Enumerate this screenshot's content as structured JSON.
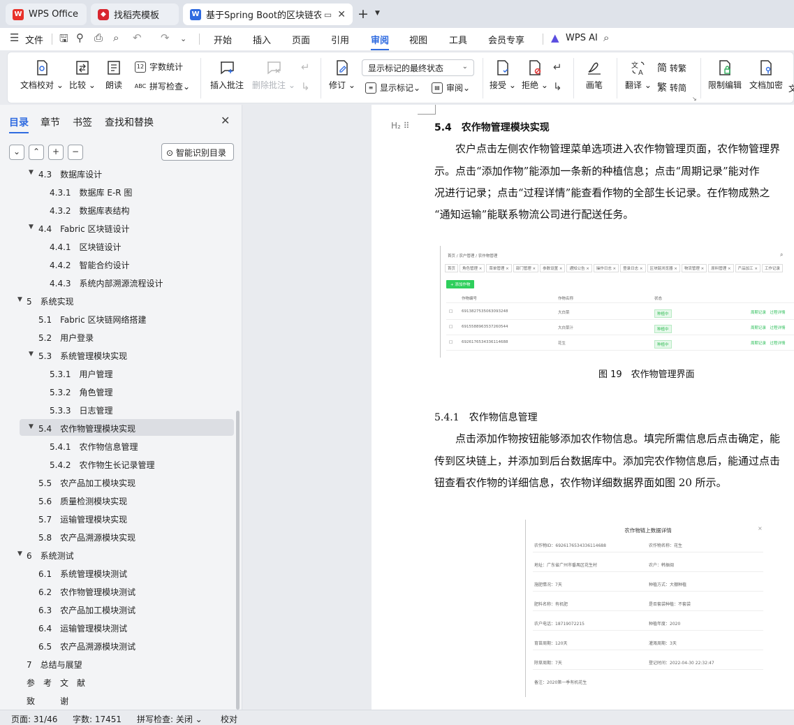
{
  "tabs": {
    "wps": "WPS Office",
    "template": "找稻壳模板",
    "doc": "基于Spring Boot的区块链农产"
  },
  "menu": {
    "file": "文件",
    "items": [
      "开始",
      "插入",
      "页面",
      "引用",
      "审阅",
      "视图",
      "工具",
      "会员专享"
    ],
    "active": "审阅",
    "wps_ai": "WPS AI"
  },
  "ribbon": {
    "doc_proof": "文档校对",
    "compare": "比较",
    "read_aloud": "朗读",
    "word_count": "字数统计",
    "spell_check": "拼写检查",
    "insert_comment": "插入批注",
    "delete_comment": "删除批注",
    "revise": "修订",
    "show_markup": "显示标记",
    "review": "审阅",
    "display_mode": "显示标记的最终状态",
    "accept": "接受",
    "reject": "拒绝",
    "pen": "画笔",
    "translate": "翻译",
    "to_traditional": "转繁",
    "to_simplified": "转简",
    "restrict_edit": "限制编辑",
    "doc_encrypt": "文档加密",
    "trailing": "文"
  },
  "nav": {
    "tabs": [
      "目录",
      "章节",
      "书签",
      "查找和替换"
    ],
    "smart_toc": "智能识别目录",
    "toc": [
      {
        "num": "4.3",
        "text": "数据库设计",
        "level": 2,
        "tw": true
      },
      {
        "num": "4.3.1",
        "text": "数据库 E-R 图",
        "level": 3
      },
      {
        "num": "4.3.2",
        "text": "数据库表结构",
        "level": 3
      },
      {
        "num": "4.4",
        "text": "Fabric 区块链设计",
        "level": 2,
        "tw": true
      },
      {
        "num": "4.4.1",
        "text": "区块链设计",
        "level": 3
      },
      {
        "num": "4.4.2",
        "text": "智能合约设计",
        "level": 3
      },
      {
        "num": "4.4.3",
        "text": "系统内部溯源流程设计",
        "level": 3
      },
      {
        "num": "5",
        "text": "系统实现",
        "level": 1,
        "tw": true
      },
      {
        "num": "5.1",
        "text": "Fabric 区块链网络搭建",
        "level": 2
      },
      {
        "num": "5.2",
        "text": "用户登录",
        "level": 2
      },
      {
        "num": "5.3",
        "text": "系统管理模块实现",
        "level": 2,
        "tw": true
      },
      {
        "num": "5.3.1",
        "text": "用户管理",
        "level": 3
      },
      {
        "num": "5.3.2",
        "text": "角色管理",
        "level": 3
      },
      {
        "num": "5.3.3",
        "text": "日志管理",
        "level": 3
      },
      {
        "num": "5.4",
        "text": "农作物管理模块实现",
        "level": 2,
        "tw": true,
        "selected": true
      },
      {
        "num": "5.4.1",
        "text": "农作物信息管理",
        "level": 3
      },
      {
        "num": "5.4.2",
        "text": "农作物生长记录管理",
        "level": 3
      },
      {
        "num": "5.5",
        "text": "农产品加工模块实现",
        "level": 2
      },
      {
        "num": "5.6",
        "text": "质量检测模块实现",
        "level": 2
      },
      {
        "num": "5.7",
        "text": "运输管理模块实现",
        "level": 2
      },
      {
        "num": "5.8",
        "text": "农产品溯源模块实现",
        "level": 2
      },
      {
        "num": "6",
        "text": "系统测试",
        "level": 1,
        "tw": true
      },
      {
        "num": "6.1",
        "text": "系统管理模块测试",
        "level": 2
      },
      {
        "num": "6.2",
        "text": "农作物管理模块测试",
        "level": 2
      },
      {
        "num": "6.3",
        "text": "农产品加工模块测试",
        "level": 2
      },
      {
        "num": "6.4",
        "text": "运输管理模块测试",
        "level": 2
      },
      {
        "num": "6.5",
        "text": "农产品溯源模块测试",
        "level": 2
      },
      {
        "num": "7",
        "text": "总结与展望",
        "level": 1
      },
      {
        "num": "",
        "text": "参　考　文　献",
        "level": 1
      },
      {
        "num": "",
        "text": "致　　　谢",
        "level": 1
      }
    ]
  },
  "doc": {
    "heading_54": "5.4　农作物管理模块实现",
    "para1": [
      "　　农户点击左侧农作物管理菜单选项进入农作物管理页面，农作物管理界",
      "示。点击“添加作物”能添加一条新的种植信息；点击“周期记录”能对作",
      "况进行记录；点击“过程详情”能查看作物的全部生长记录。在作物成熟之",
      "“通知运输”能联系物流公司进行配送任务。"
    ],
    "caption_19": "图 19　农作物管理界面",
    "heading_541": "5.4.1　农作物信息管理",
    "para2": [
      "　　点击添加作物按钮能够添加农作物信息。填完所需信息后点击确定，能",
      "传到区块链上，并添加到后台数据库中。添加完农作物信息后，能通过点击",
      "钮查看农作物的详细信息，农作物详细数据界面如图 20 所示。"
    ],
    "shot1": {
      "breadcrumb": "首页 / 农户管理 / 农作物管理",
      "tabs": [
        "首页",
        "角色管理 ×",
        "菜单管理 ×",
        "部门管理 ×",
        "参数设置 ×",
        "通知公告 ×",
        "操作日志 ×",
        "登录日志 ×",
        "区块链浏览器 ×",
        "物流管理 ×",
        "原料管理 ×",
        "产品加工 ×",
        "工作记录"
      ],
      "add_btn": "+ 添加作物",
      "headers": [
        "作物编号",
        "作物名称",
        "状态"
      ],
      "rows": [
        {
          "id": "6913827535063093248",
          "name": "大白菜",
          "status": "种植中",
          "actions": "周期记录　过程详情"
        },
        {
          "id": "6915588963537260544",
          "name": "大白菜汁",
          "status": "种植中",
          "actions": "周期记录　过程详情"
        },
        {
          "id": "6926176534336114688",
          "name": "花生",
          "status": "种植中",
          "actions": "周期记录　过程详情"
        }
      ]
    },
    "shot2": {
      "title": "农作物链上数据详情",
      "close": "×",
      "fields": [
        [
          "农作物ID：6926176534336114688",
          "农作物名称：花生"
        ],
        [
          "地址：广东省广州市番禺区花生村",
          "农户：韩振闽"
        ],
        [
          "施肥情况：7天",
          "种植方式：大棚种植"
        ],
        [
          "肥料名称：有机肥",
          "是否套袋种植：不套袋"
        ],
        [
          "农户电话：18719072215",
          "种植年度：2020"
        ],
        [
          "育苗周期：120天",
          "灌溉周期：3天"
        ],
        [
          "除草周期：7天",
          "登记时间：2022-04-30 22:32:47"
        ],
        [
          "备注：2020第一季有机花生",
          ""
        ]
      ]
    }
  },
  "status": {
    "page": "页面: 31/46",
    "words": "字数: 17451",
    "spell": "拼写检查: 关闭",
    "proof": "校对"
  }
}
